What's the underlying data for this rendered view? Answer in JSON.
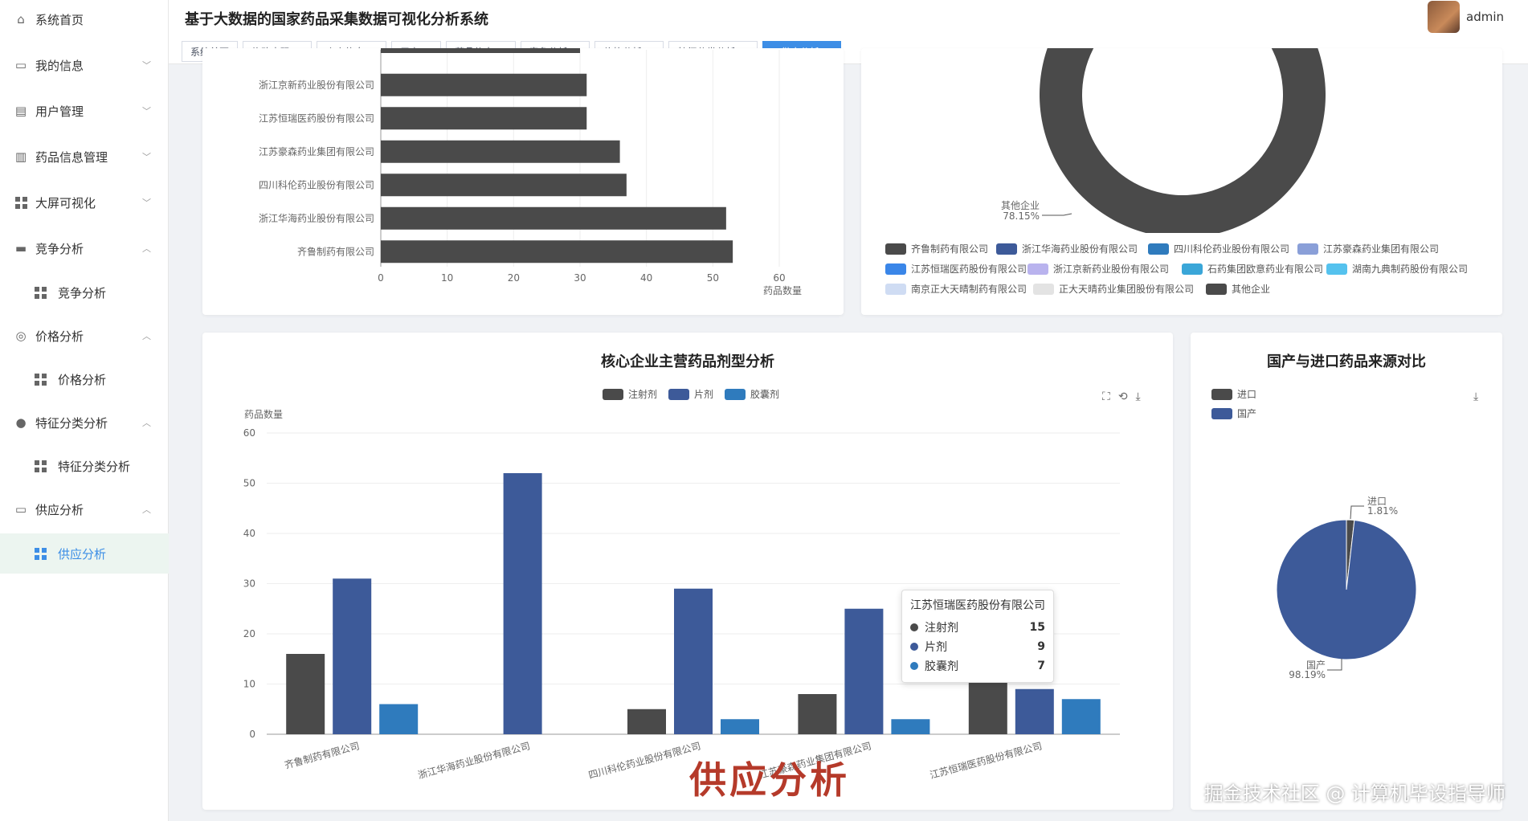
{
  "header": {
    "system_title": "基于大数据的国家药品采集数据可视化分析系统",
    "user": "admin"
  },
  "sidebar": {
    "items": [
      {
        "label": "系统首页"
      },
      {
        "label": "我的信息"
      },
      {
        "label": "用户管理"
      },
      {
        "label": "药品信息管理"
      },
      {
        "label": "大屏可视化"
      },
      {
        "label": "竞争分析"
      },
      {
        "label": "竞争分析"
      },
      {
        "label": "价格分析"
      },
      {
        "label": "价格分析"
      },
      {
        "label": "特征分类分析"
      },
      {
        "label": "特征分类分析"
      },
      {
        "label": "供应分析"
      },
      {
        "label": "供应分析"
      }
    ]
  },
  "tabs": [
    {
      "label": "系统首页"
    },
    {
      "label": "修改密码"
    },
    {
      "label": "个人信息"
    },
    {
      "label": "用户"
    },
    {
      "label": "药品信息"
    },
    {
      "label": "竞争分析"
    },
    {
      "label": "价格分析"
    },
    {
      "label": "特征分类分析"
    },
    {
      "label": "供应分析"
    }
  ],
  "colors": {
    "accent": "#3d8ee6",
    "series1": "#4a4a4a",
    "series2": "#3d5a99",
    "series3": "#2f7bbd"
  },
  "chart_data": [
    {
      "type": "bar",
      "orientation": "horizontal",
      "categories": [
        "齐鲁制药有限公司",
        "浙江华海药业股份有限公司",
        "四川科伦药业股份有限公司",
        "江苏豪森药业集团有限公司",
        "江苏恒瑞医药股份有限公司",
        "浙江京新药业股份有限公司"
      ],
      "values": [
        53,
        52,
        37,
        36,
        31,
        31
      ],
      "xlabel": "药品数量",
      "xlim": [
        0,
        60
      ],
      "xticks": [
        0,
        10,
        20,
        30,
        40,
        50,
        60
      ]
    },
    {
      "type": "pie",
      "variant": "donut",
      "legend": [
        "齐鲁制药有限公司",
        "浙江华海药业股份有限公司",
        "四川科伦药业股份有限公司",
        "江苏豪森药业集团有限公司",
        "江苏恒瑞医药股份有限公司",
        "浙江京新药业股份有限公司",
        "石药集团欧意药业有限公司",
        "湖南九典制药股份有限公司",
        "南京正大天晴制药有限公司",
        "正大天晴药业集团股份有限公司",
        "其他企业"
      ],
      "legend_colors": [
        "#4a4a4a",
        "#3d5a99",
        "#2f7bbd",
        "#8a9fd8",
        "#3a86e8",
        "#b9b3ee",
        "#3aa6d8",
        "#55c2ee",
        "#cfdcf3",
        "#e3e3e3",
        "#4a4a4a"
      ],
      "label": {
        "name": "其他企业",
        "percent": "78.15%"
      }
    },
    {
      "type": "bar",
      "title": "核心企业主营药品剂型分析",
      "ylabel": "药品数量",
      "ylim": [
        0,
        60
      ],
      "yticks": [
        0,
        10,
        20,
        30,
        40,
        50,
        60
      ],
      "categories": [
        "齐鲁制药有限公司",
        "浙江华海药业股份有限公司",
        "四川科伦药业股份有限公司",
        "江苏豪森药业集团有限公司",
        "江苏恒瑞医药股份有限公司"
      ],
      "series": [
        {
          "name": "注射剂",
          "values": [
            16,
            0,
            5,
            8,
            15
          ]
        },
        {
          "name": "片剂",
          "values": [
            31,
            52,
            29,
            25,
            9
          ]
        },
        {
          "name": "胶囊剂",
          "values": [
            6,
            0,
            3,
            3,
            7
          ]
        }
      ],
      "tooltip": {
        "title": "江苏恒瑞医药股份有限公司",
        "rows": [
          {
            "name": "注射剂",
            "value": "15"
          },
          {
            "name": "片剂",
            "value": "9"
          },
          {
            "name": "胶囊剂",
            "value": "7"
          }
        ]
      }
    },
    {
      "type": "pie",
      "title": "国产与进口药品来源对比",
      "slices": [
        {
          "name": "进口",
          "percent": 1.81,
          "label": "1.81%"
        },
        {
          "name": "国产",
          "percent": 98.19,
          "label": "98.19%"
        }
      ]
    }
  ],
  "overlay": {
    "title": "供应分析",
    "watermark": "掘金技术社区 @ 计算机毕设指导师"
  }
}
